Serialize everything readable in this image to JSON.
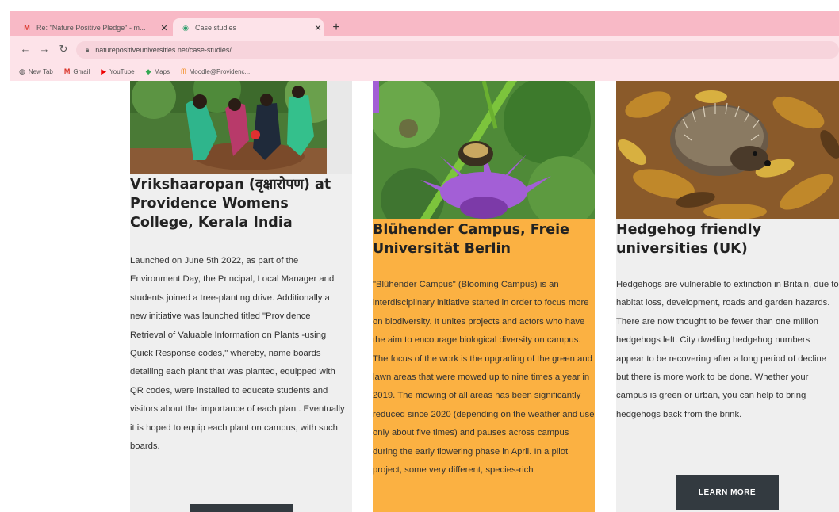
{
  "browser": {
    "tabs": [
      {
        "title": "Re: \"Nature Positive Pledge\" - m...",
        "favicon": "gmail-icon",
        "active": false
      },
      {
        "title": "Case studies",
        "favicon": "site-icon",
        "active": true
      }
    ],
    "new_tab_label": "+",
    "url": "naturepositiveuniversities.net/case-studies/",
    "bookmarks": [
      {
        "label": "New Tab",
        "icon": "globe-icon"
      },
      {
        "label": "Gmail",
        "icon": "gmail-icon"
      },
      {
        "label": "YouTube",
        "icon": "youtube-icon"
      },
      {
        "label": "Maps",
        "icon": "maps-icon"
      },
      {
        "label": "Moodle@Providenc...",
        "icon": "moodle-icon"
      }
    ]
  },
  "cards": [
    {
      "title": "Vrikshaaropan (वृक्षारोपण) at Providence Womens College, Kerala India",
      "body": "Launched on June 5th 2022, as part of the Environment Day, the Principal, Local Manager and students joined a tree-planting drive. Additionally a new initiative was launched titled \"Providence Retrieval of Valuable Information on Plants -using Quick Response codes,\" whereby, name boards detailing each plant that was planted, equipped with QR codes, were installed to educate students and visitors about the importance of each plant. Eventually it is hoped to equip each plant on campus, with such boards.",
      "background": "#efefef"
    },
    {
      "title": "Blühender Campus, Freie Universität Berlin",
      "body": "\"Blühender Campus\" (Blooming Campus) is an interdisciplinary initiative started in order to focus more on biodiversity. It unites projects and actors who have the aim to encourage biological diversity on campus. The focus of the work is the upgrading of the green and lawn areas that were mowed up to nine times a year in 2019. The mowing of all areas has been significantly reduced since 2020 (depending on the weather and use only about five times) and pauses across campus during the early flowering phase in April. In a pilot project, some very different, species-rich",
      "background": "#fbb142"
    },
    {
      "title": "Hedgehog friendly universities (UK)",
      "body": "Hedgehogs are vulnerable to extinction in Britain, due to habitat loss, development, roads and garden hazards. There are now thought to be fewer than one million hedgehogs left. City dwelling hedgehog numbers appear to be recovering after a long period of decline but there is more work to be done. Whether your campus is green or urban, you can help to bring hedgehogs back from the brink.",
      "button": "LEARN MORE",
      "background": "#efefef"
    }
  ]
}
